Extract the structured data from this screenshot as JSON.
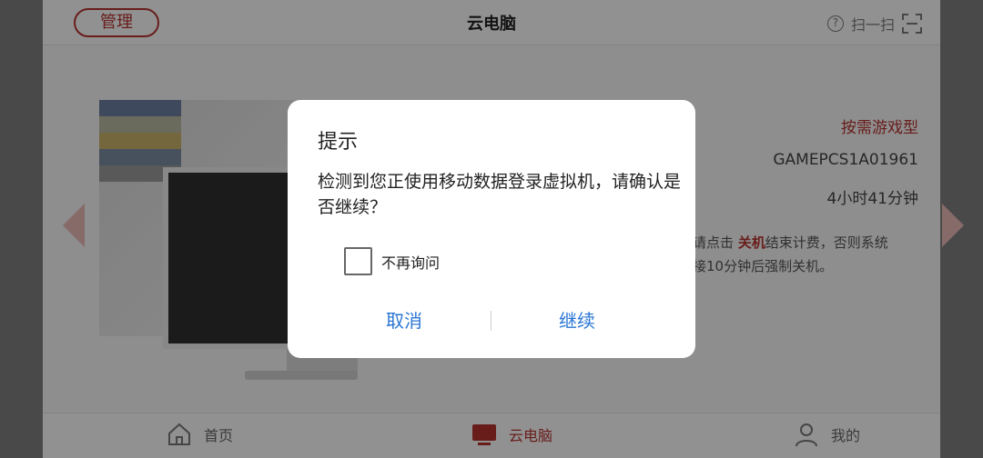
{
  "header": {
    "manage_label": "管理",
    "title": "云电脑",
    "scan_label": "扫一扫"
  },
  "content": {
    "type_label": "按需游戏型",
    "code": "GAMEPCS1A01961",
    "time": "4小时41分钟",
    "notice_prefix": "请点击 ",
    "notice_highlight": "关机",
    "notice_suffix": "结束计费，否则系统",
    "notice_line2": "接10分钟后强制关机。"
  },
  "dialog": {
    "title": "提示",
    "message": "检测到您正使用移动数据登录虚拟机，请确认是否继续？",
    "checkbox_label": "不再询问",
    "cancel_label": "取消",
    "continue_label": "继续"
  },
  "tabbar": {
    "items": [
      {
        "label": "首页",
        "icon": "home-icon"
      },
      {
        "label": "云电脑",
        "icon": "computer-icon"
      },
      {
        "label": "我的",
        "icon": "user-icon"
      }
    ]
  },
  "colors": {
    "accent": "#b3332f",
    "link": "#2a76d4",
    "overlay": "rgba(0,0,0,0.42)"
  }
}
